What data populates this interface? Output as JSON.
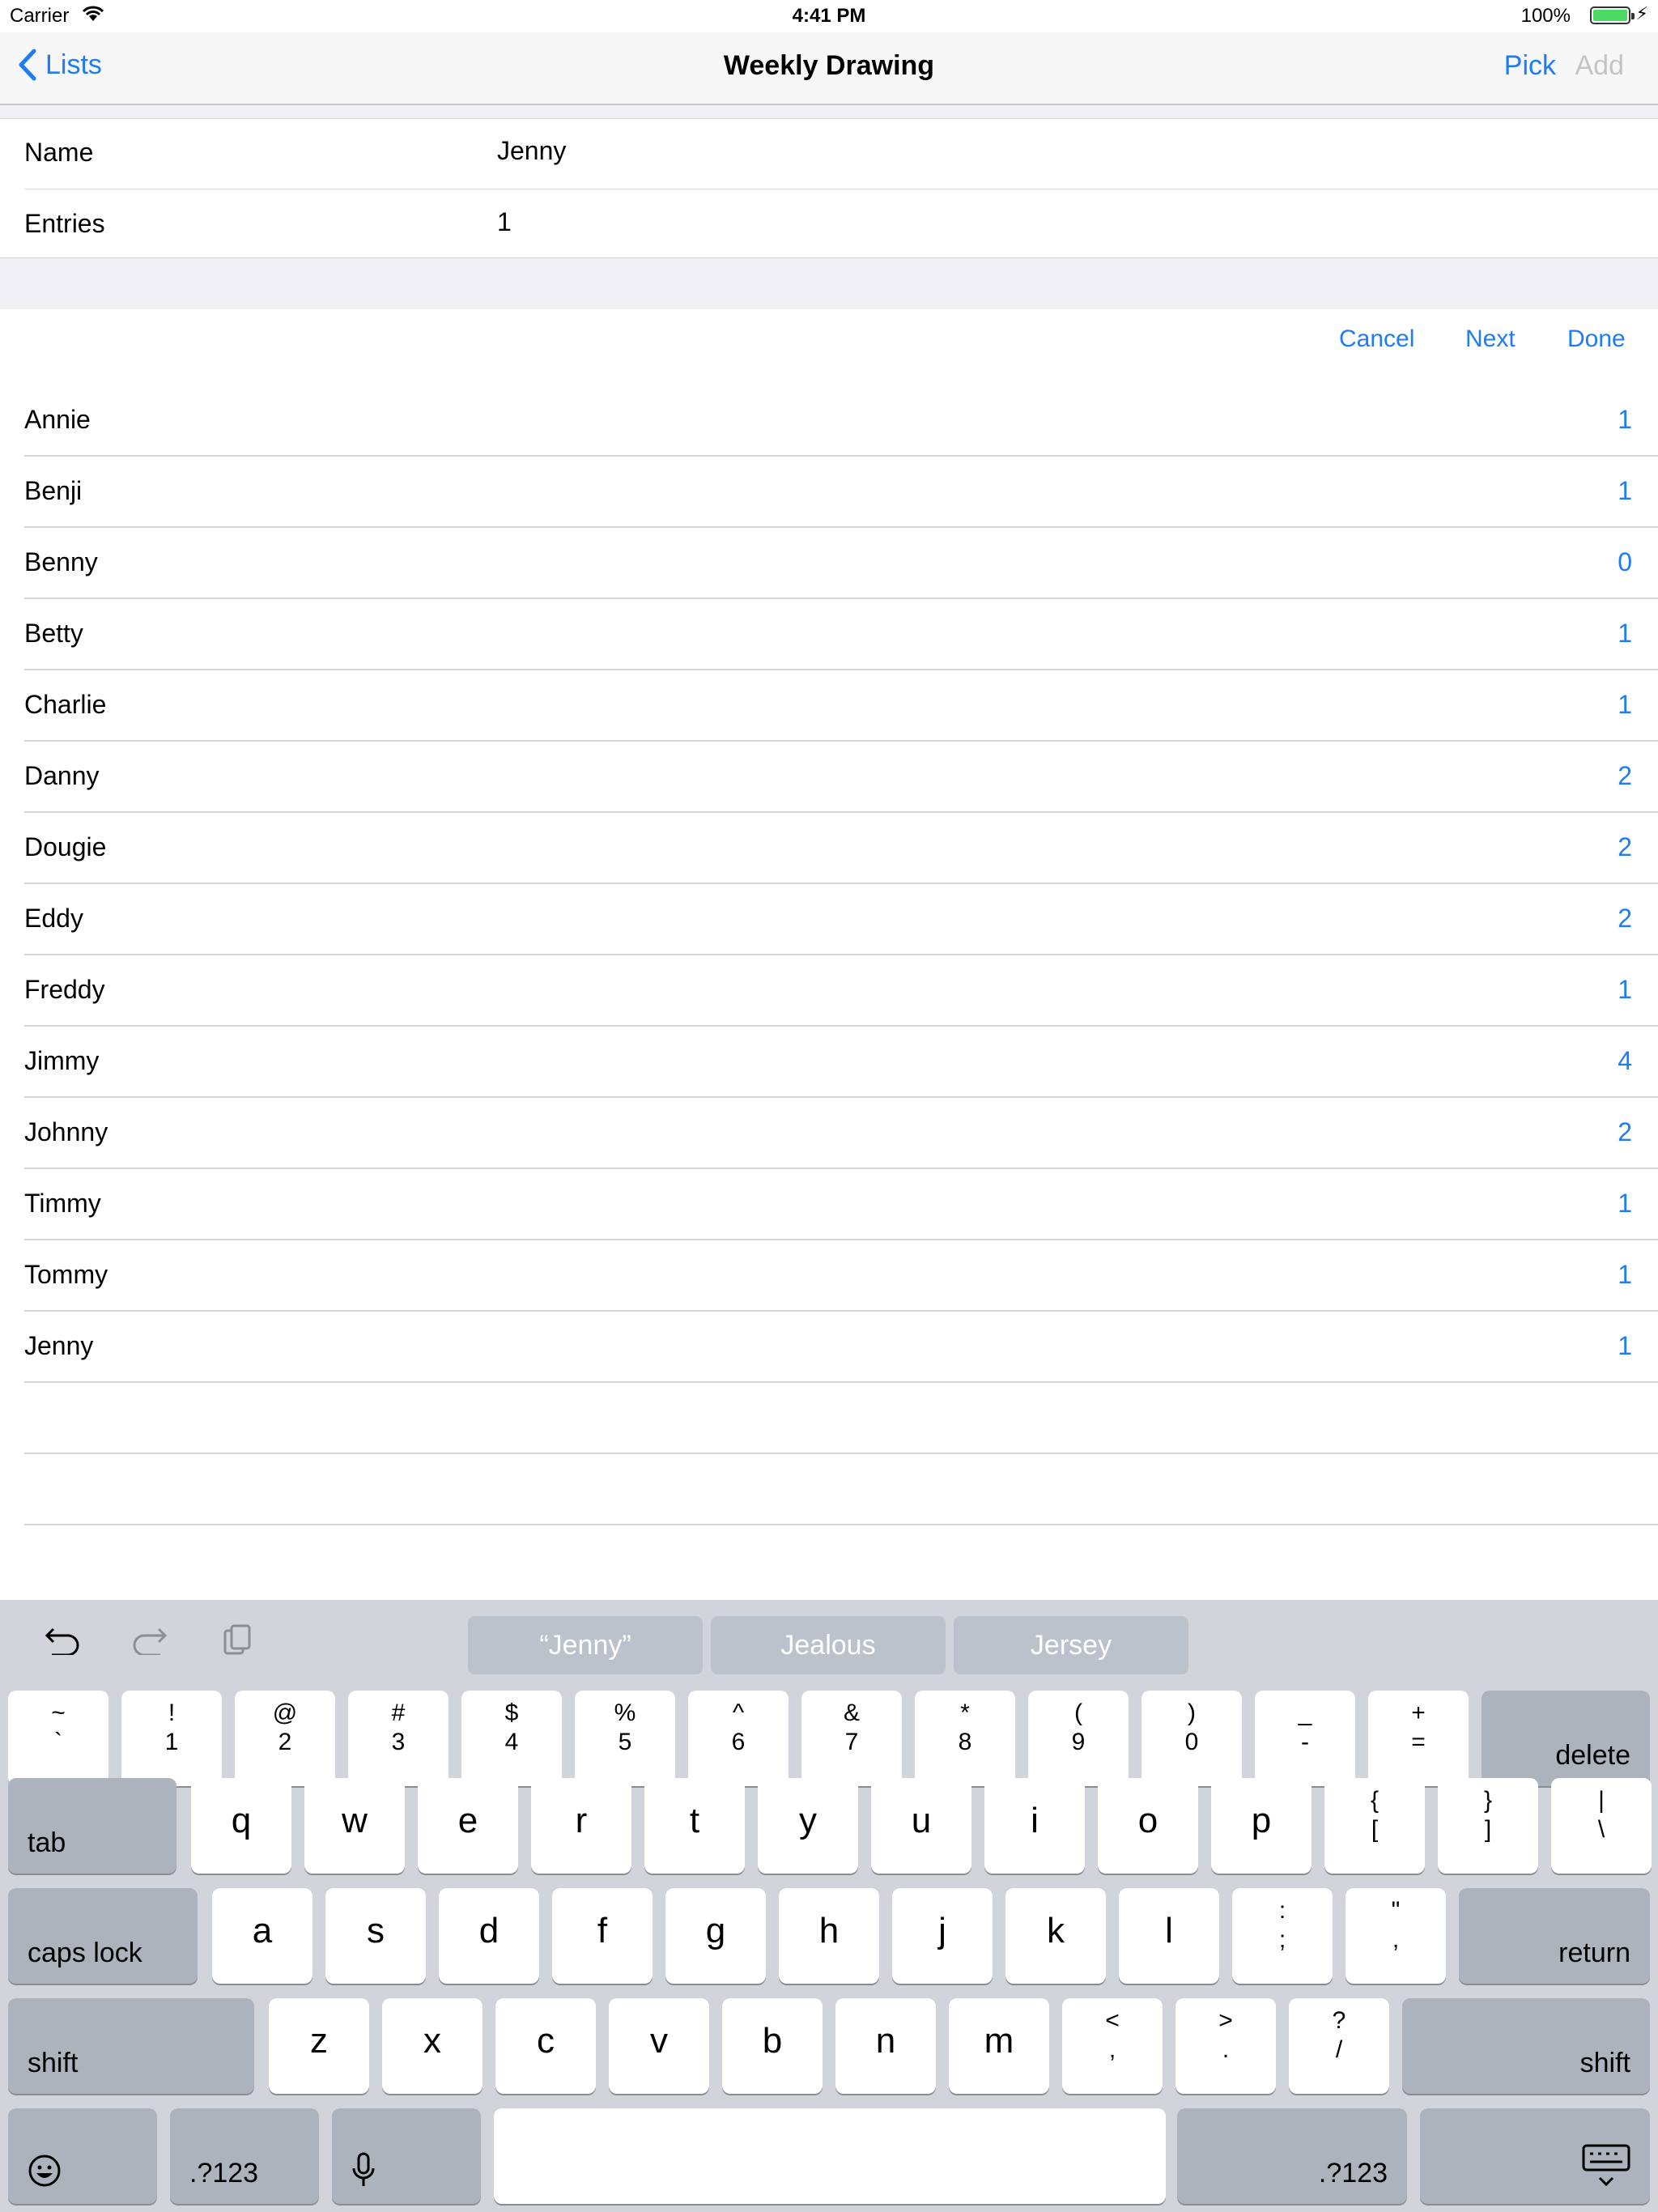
{
  "status": {
    "carrier": "Carrier",
    "time": "4:41 PM",
    "battery": "100%"
  },
  "nav": {
    "back": "Lists",
    "title": "Weekly Drawing",
    "pick": "Pick",
    "add": "Add"
  },
  "form": {
    "name_label": "Name",
    "name_value": "Jenny",
    "entries_label": "Entries",
    "entries_value": "1"
  },
  "toolbar": {
    "cancel": "Cancel",
    "next": "Next",
    "done": "Done"
  },
  "people": [
    {
      "name": "Annie",
      "count": "1"
    },
    {
      "name": "Benji",
      "count": "1"
    },
    {
      "name": "Benny",
      "count": "0"
    },
    {
      "name": "Betty",
      "count": "1"
    },
    {
      "name": "Charlie",
      "count": "1"
    },
    {
      "name": "Danny",
      "count": "2"
    },
    {
      "name": "Dougie",
      "count": "2"
    },
    {
      "name": "Eddy",
      "count": "2"
    },
    {
      "name": "Freddy",
      "count": "1"
    },
    {
      "name": "Jimmy",
      "count": "4"
    },
    {
      "name": "Johnny",
      "count": "2"
    },
    {
      "name": "Timmy",
      "count": "1"
    },
    {
      "name": "Tommy",
      "count": "1"
    },
    {
      "name": "Jenny",
      "count": "1"
    }
  ],
  "keyboard": {
    "suggestions": [
      "“Jenny”",
      "Jealous",
      "Jersey"
    ],
    "row1": [
      [
        "~",
        "`"
      ],
      [
        "!",
        "1"
      ],
      [
        "@",
        "2"
      ],
      [
        "#",
        "3"
      ],
      [
        "$",
        "4"
      ],
      [
        "%",
        "5"
      ],
      [
        "^",
        "6"
      ],
      [
        "&",
        "7"
      ],
      [
        "*",
        "8"
      ],
      [
        "(",
        "9"
      ],
      [
        ")",
        "0"
      ],
      [
        "_",
        "-"
      ],
      [
        "+",
        "="
      ]
    ],
    "delete": "delete",
    "tab": "tab",
    "row2": [
      "q",
      "w",
      "e",
      "r",
      "t",
      "y",
      "u",
      "i",
      "o",
      "p"
    ],
    "row2_sym": [
      [
        "{",
        "["
      ],
      [
        "}",
        "]"
      ],
      [
        "|",
        "\\"
      ]
    ],
    "caps": "caps lock",
    "row3": [
      "a",
      "s",
      "d",
      "f",
      "g",
      "h",
      "j",
      "k",
      "l"
    ],
    "row3_sym": [
      [
        ":",
        ";"
      ],
      [
        "\"",
        ","
      ]
    ],
    "return": "return",
    "shift": "shift",
    "row4": [
      "z",
      "x",
      "c",
      "v",
      "b",
      "n",
      "m"
    ],
    "row4_sym": [
      [
        "<",
        ","
      ],
      [
        ">",
        "."
      ],
      [
        "?",
        "/"
      ]
    ],
    "num": ".?123"
  },
  "colors": {
    "accent": "#1f7cf7",
    "keyboard_bg": "#d1d5db",
    "key_dark": "#acb3bd"
  }
}
